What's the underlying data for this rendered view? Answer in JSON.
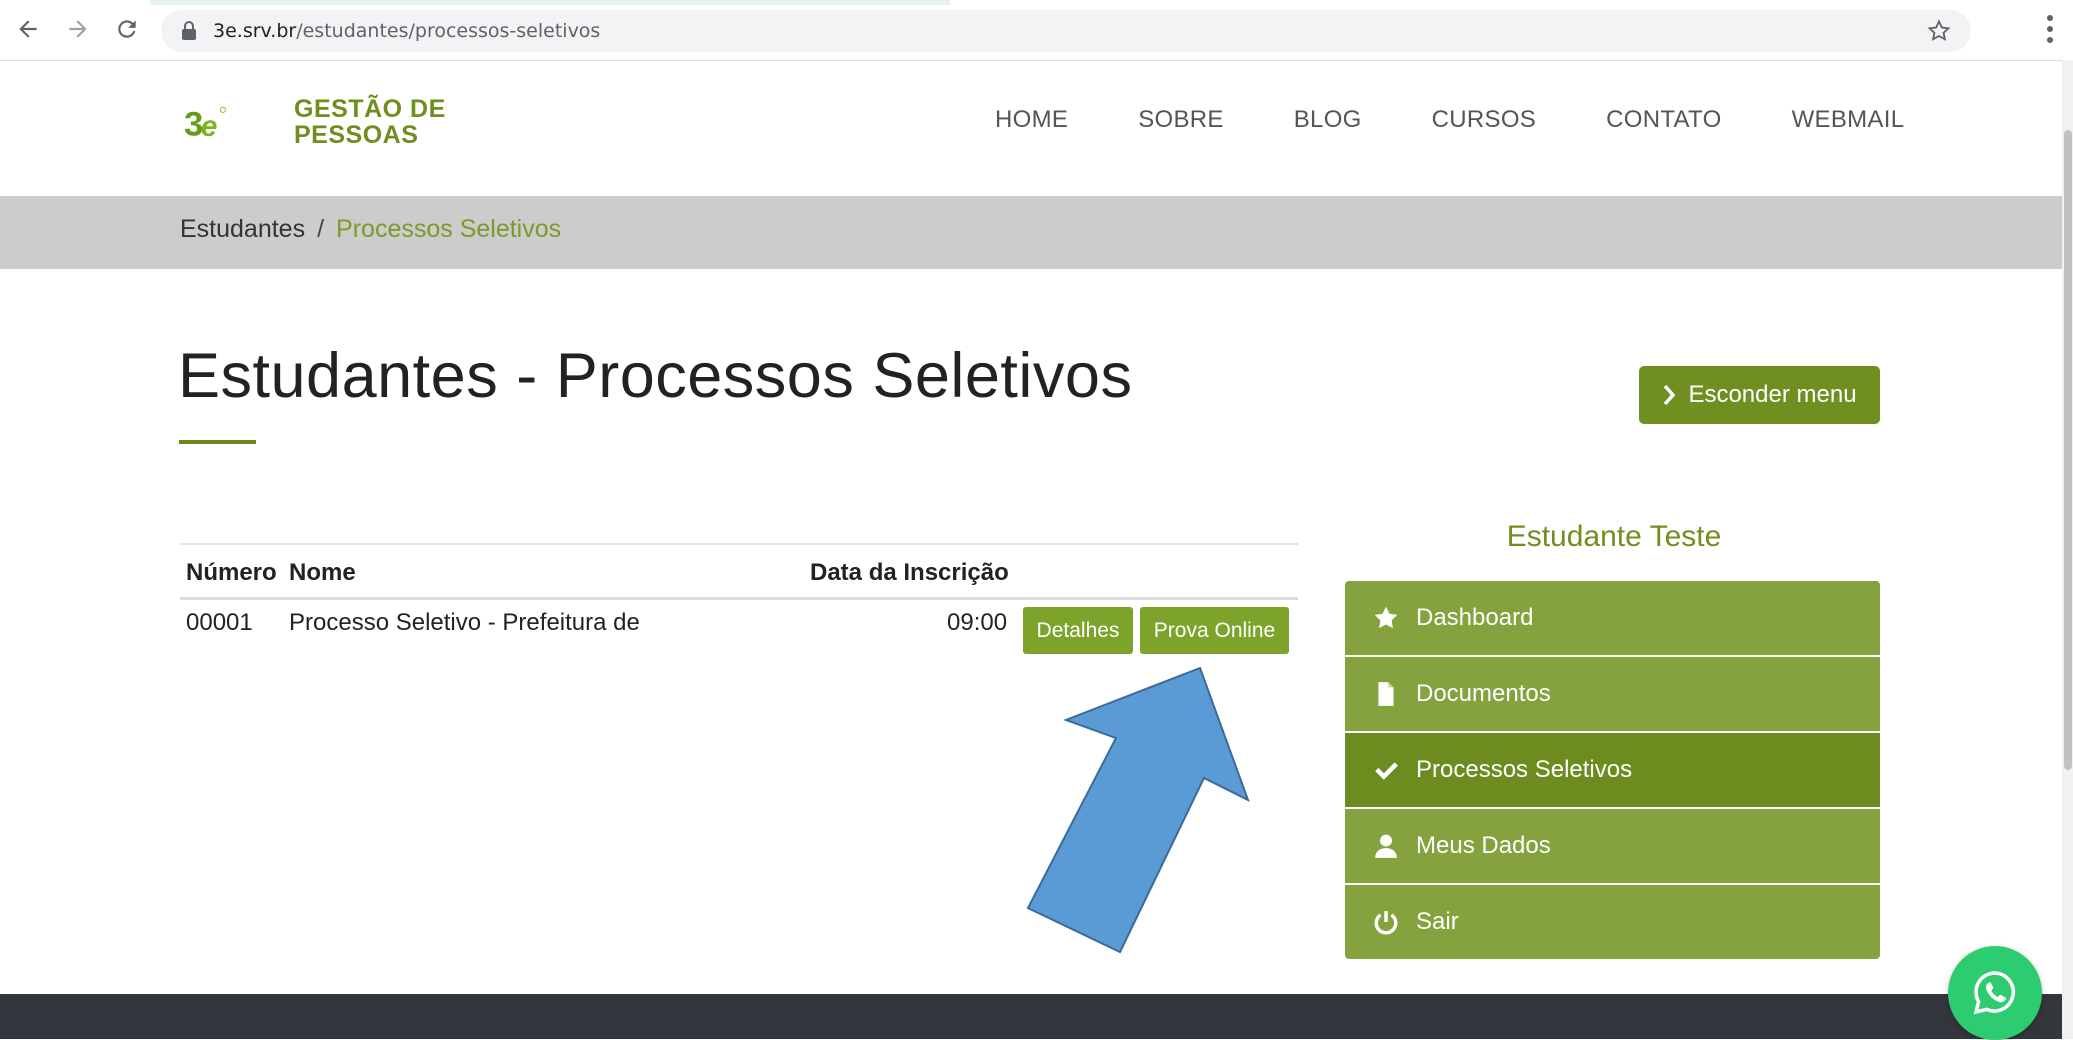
{
  "browser": {
    "url_host": "3e.srv.br",
    "url_path": "/estudantes/processos-seletivos"
  },
  "logo": {
    "line1": "GESTÃO DE",
    "line2": "PESSOAS",
    "mark": "3e"
  },
  "topnav": [
    "HOME",
    "SOBRE",
    "BLOG",
    "CURSOS",
    "CONTATO",
    "WEBMAIL"
  ],
  "breadcrumb": {
    "parent": "Estudantes",
    "separator": "/",
    "current": "Processos Seletivos"
  },
  "page": {
    "title": "Estudantes - Processos Seletivos",
    "hide_menu_label": "Esconder menu"
  },
  "table": {
    "headers": {
      "number": "Número",
      "name": "Nome",
      "date": "Data da Inscrição"
    },
    "rows": [
      {
        "number": "00001",
        "name": "Processo Seletivo - Prefeitura de ",
        "time": "09:00",
        "btn_details": "Detalhes",
        "btn_exam": "Prova Online"
      }
    ]
  },
  "sidebar": {
    "student_name": "Estudante Teste",
    "items": [
      {
        "label": "Dashboard",
        "icon": "star-icon"
      },
      {
        "label": "Documentos",
        "icon": "document-icon"
      },
      {
        "label": "Processos Seletivos",
        "icon": "check-icon",
        "active": true
      },
      {
        "label": "Meus Dados",
        "icon": "user-icon"
      },
      {
        "label": "Sair",
        "icon": "power-icon"
      }
    ]
  },
  "colors": {
    "brand_green": "#6f8f20",
    "menu_green": "#84a23d",
    "arrow_blue": "#5b9bd5",
    "footer": "#33373d"
  }
}
